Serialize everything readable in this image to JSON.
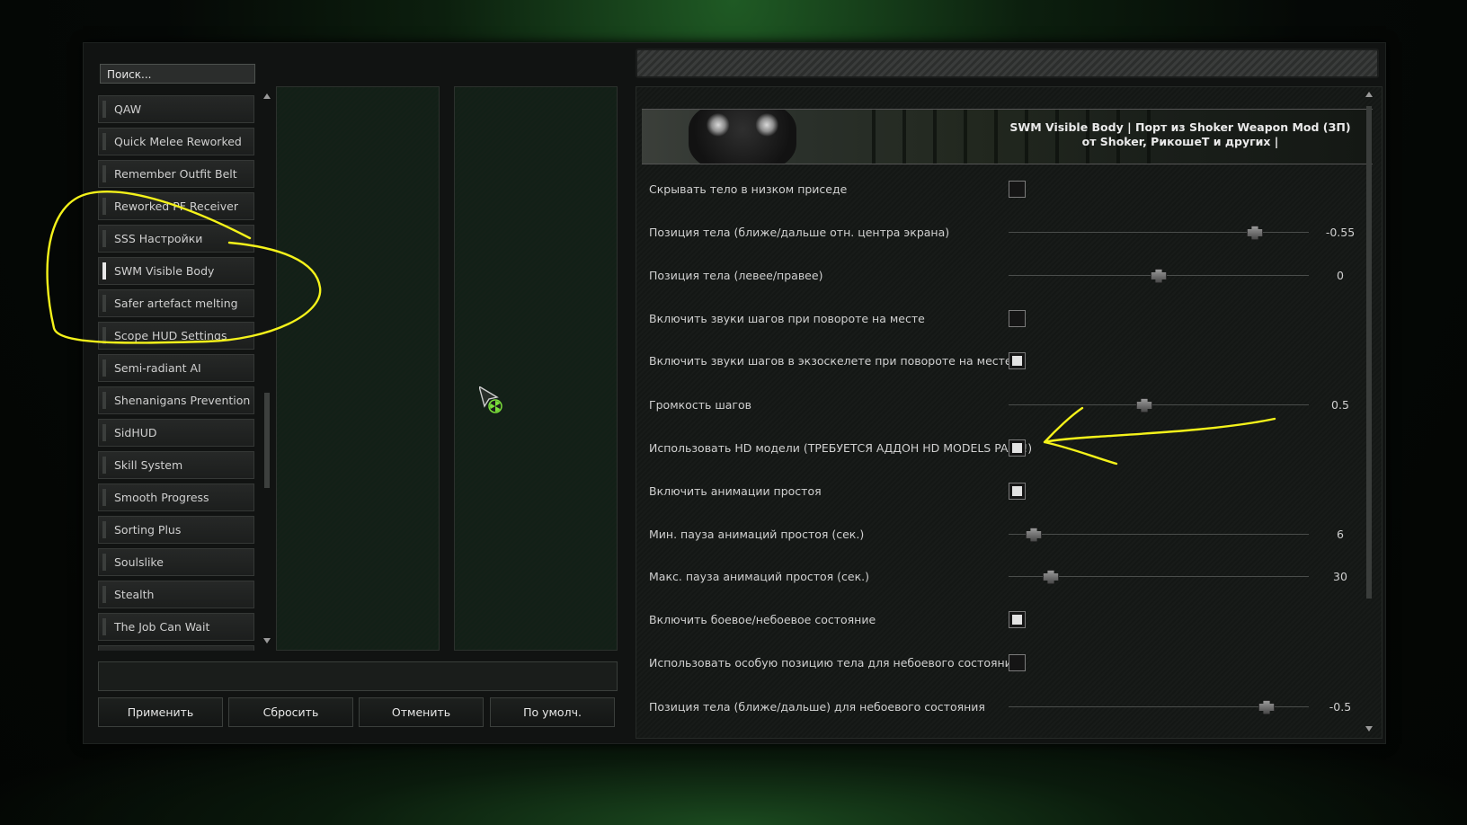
{
  "search": {
    "placeholder": "Поиск..."
  },
  "mod_list": {
    "items": [
      {
        "label": "QAW",
        "selected": false
      },
      {
        "label": "Quick Melee Reworked",
        "selected": false
      },
      {
        "label": "Remember Outfit Belt",
        "selected": false
      },
      {
        "label": "Reworked PF Receiver",
        "selected": false
      },
      {
        "label": "SSS Настройки",
        "selected": false
      },
      {
        "label": "SWM Visible Body",
        "selected": true
      },
      {
        "label": "Safer artefact melting",
        "selected": false
      },
      {
        "label": "Scope HUD Settings",
        "selected": false
      },
      {
        "label": "Semi-radiant AI",
        "selected": false
      },
      {
        "label": "Shenanigans Prevention",
        "selected": false
      },
      {
        "label": "SidHUD",
        "selected": false
      },
      {
        "label": "Skill System",
        "selected": false
      },
      {
        "label": "Smooth Progress",
        "selected": false
      },
      {
        "label": "Sorting Plus",
        "selected": false
      },
      {
        "label": "Soulslike",
        "selected": false
      },
      {
        "label": "Stealth",
        "selected": false
      },
      {
        "label": "The Job Can Wait",
        "selected": false
      }
    ]
  },
  "buttons": {
    "apply": "Применить",
    "reset": "Сбросить",
    "cancel": "Отменить",
    "default": "По умолч."
  },
  "options": {
    "title": "SWM Visible Body | Порт из Shoker Weapon Mod (ЗП) от Shoker, РикошеТ и других |",
    "rows": [
      {
        "label": "Скрывать тело в низком приседе",
        "type": "checkbox",
        "checked": false
      },
      {
        "label": "Позиция тела (ближе/дальше отн. центра экрана)",
        "type": "slider",
        "value": "-0.55",
        "fraction": 0.84
      },
      {
        "label": "Позиция тела (левее/правее)",
        "type": "slider",
        "value": "0",
        "fraction": 0.5
      },
      {
        "label": "Включить звуки шагов при повороте на месте",
        "type": "checkbox",
        "checked": false
      },
      {
        "label": "Включить звуки шагов в экзоскелете при повороте на месте",
        "type": "checkbox",
        "checked": true
      },
      {
        "label": "Громкость шагов",
        "type": "slider",
        "value": "0.5",
        "fraction": 0.45
      },
      {
        "label": "Использовать HD модели (ТРЕБУЕТСЯ АДДОН HD MODELS PACK!)",
        "type": "checkbox",
        "checked": true
      },
      {
        "label": "Включить анимации простоя",
        "type": "checkbox",
        "checked": true
      },
      {
        "label": "Мин. пауза анимаций простоя (сек.)",
        "type": "slider",
        "value": "6",
        "fraction": 0.06
      },
      {
        "label": "Макс. пауза анимаций простоя (сек.)",
        "type": "slider",
        "value": "30",
        "fraction": 0.12
      },
      {
        "label": "Включить боевое/небоевое состояние",
        "type": "checkbox",
        "checked": true
      },
      {
        "label": "Использовать особую позицию тела для небоевого состояния",
        "type": "checkbox",
        "checked": false
      },
      {
        "label": "Позиция тела (ближе/дальше) для небоевого состояния",
        "type": "slider",
        "value": "-0.5",
        "fraction": 0.88
      }
    ]
  },
  "colors": {
    "annotation": "#f4f21a",
    "accent": "#e2e2e2"
  }
}
